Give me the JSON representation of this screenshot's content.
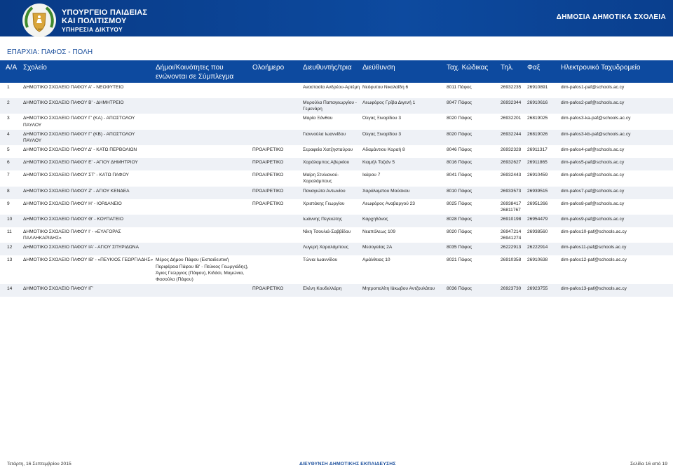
{
  "header": {
    "ministry_line1": "ΥΠΟΥΡΓΕΙΟ ΠΑΙΔΕΙΑΣ",
    "ministry_line2": "ΚΑΙ ΠΟΛΙΤΙΣΜΟΥ",
    "ministry_line3": "ΥΠΗΡΕΣΙΑ ΔΙΚΤΥΟΥ",
    "doc_title": "ΔΗΜΟΣΙΑ ΔΗΜΟΤΙΚΑ ΣΧΟΛΕΙΑ",
    "emblem_icon": "cyprus-emblem-icon"
  },
  "province_label": "ΕΠΑΡΧΙΑ:  ΠΑΦΟΣ - ΠΟΛΗ",
  "columns": {
    "aa": "Α/Α",
    "school": "Σχολείο",
    "communities": "Δήμοι/Κοινότητες που ενώνονται σε Σύμπλεγμα",
    "allday": "Ολοήμερο",
    "principal": "Διευθυντής/τρια",
    "address": "Διεύθυνση",
    "postcode": "Ταχ. Κώδικας",
    "phone": "Τηλ.",
    "fax": "Φαξ",
    "email": "Ηλεκτρονικό Ταχυδρομείο"
  },
  "rows": [
    {
      "aa": "1",
      "school": "ΔΗΜΟΤΙΚΟ ΣΧΟΛΕΙΟ ΠΑΦΟΥ Α' - ΝΕΟΦΥΤΕΙΟ",
      "communities": "",
      "allday": "",
      "principal": "Αναστασία Ανδρέου-Αρτέμη",
      "address": "Νεόφυτου Νικολαΐδη 6",
      "postcode": "8011 Πάφος",
      "phone": "26932235",
      "fax": "26910891",
      "email": "dim-pafos1-paf@schools.ac.cy"
    },
    {
      "aa": "2",
      "school": "ΔΗΜΟΤΙΚΟ ΣΧΟΛΕΙΟ ΠΑΦΟΥ Β' - ΔΗΜΗΤΡΕΙΟ",
      "communities": "",
      "allday": "",
      "principal": "Μυρούλα Παπαγεωργίου - Γεμενάρη",
      "address": "Λεωφόρος Γρίβα Διγενή 1",
      "postcode": "8047 Πάφος",
      "phone": "26932344",
      "fax": "26910616",
      "email": "dim-pafos2-paf@schools.ac.cy"
    },
    {
      "aa": "3",
      "school": "ΔΗΜΟΤΙΚΟ ΣΧΟΛΕΙΟ ΠΑΦΟΥ Γ' (ΚΑ) - ΑΠΟΣΤΟΛΟΥ ΠΑΥΛΟΥ",
      "communities": "",
      "allday": "",
      "principal": "Μαρία Ξάνθου",
      "address": "Όλγας Ξιναρίδου 3",
      "postcode": "8020 Πάφος",
      "phone": "26932201",
      "fax": "26819025",
      "email": "dim-pafos3-ka-paf@schools.ac.cy"
    },
    {
      "aa": "4",
      "school": "ΔΗΜΟΤΙΚΟ ΣΧΟΛΕΙΟ ΠΑΦΟΥ Γ' (ΚΒ) - ΑΠΟΣΤΟΛΟΥ ΠΑΥΛΟΥ",
      "communities": "",
      "allday": "",
      "principal": "Γιαννούλα Ιωαννίδου",
      "address": "Όλγας Ξιναρίδου 3",
      "postcode": "8020 Πάφος",
      "phone": "26932244",
      "fax": "26819026",
      "email": "dim-pafos3-kb-paf@schools.ac.cy"
    },
    {
      "aa": "5",
      "school": "ΔΗΜΟΤΙΚΟ ΣΧΟΛΕΙΟ ΠΑΦΟΥ Δ' - ΚΑΤΩ ΠΕΡΒΟΛΙΩΝ",
      "communities": "",
      "allday": "ΠΡΟΑΙΡΕΤΙΚΟ",
      "principal": "Σεραφεία Χατζησταύρου",
      "address": "Αδαμάντιου Κοραή 8",
      "postcode": "8046 Πάφος",
      "phone": "26932328",
      "fax": "26911317",
      "email": "dim-pafos4-paf@schools.ac.cy"
    },
    {
      "aa": "6",
      "school": "ΔΗΜΟΤΙΚΟ ΣΧΟΛΕΙΟ ΠΑΦΟΥ Ε' - ΑΓΙΟΥ ΔΗΜΗΤΡΙΟΥ",
      "communities": "",
      "allday": "ΠΡΟΑΙΡΕΤΙΚΟ",
      "principal": "Χαράλαμπος Αβερκίου",
      "address": "Κιαμήλ Τοζιάν 5",
      "postcode": "8016 Πάφος",
      "phone": "26932627",
      "fax": "26911865",
      "email": "dim-pafos5-paf@schools.ac.cy"
    },
    {
      "aa": "7",
      "school": "ΔΗΜΟΤΙΚΟ ΣΧΟΛΕΙΟ ΠΑΦΟΥ ΣΤ' - ΚΑΤΩ ΠΑΦΟΥ",
      "communities": "",
      "allday": "ΠΡΟΑΙΡΕΤΙΚΟ",
      "principal": "Μαίρη Στυλιανού-Χαραλάμπους",
      "address": "Ικάρου 7",
      "postcode": "8041 Πάφος",
      "phone": "26932443",
      "fax": "26910459",
      "email": "dim-pafos6-paf@schools.ac.cy"
    },
    {
      "aa": "8",
      "school": "ΔΗΜΟΤΙΚΟ ΣΧΟΛΕΙΟ ΠΑΦΟΥ Ζ' - ΑΓΙΟΥ ΚΕΝΔΕΑ",
      "communities": "",
      "allday": "ΠΡΟΑΙΡΕΤΙΚΟ",
      "principal": "Παναγιώτα Αντωνίου",
      "address": "Χαράλαμπου Μούσκου",
      "postcode": "8010 Πάφος",
      "phone": "26933573",
      "fax": "26939515",
      "email": "dim-pafos7-paf@schools.ac.cy"
    },
    {
      "aa": "9",
      "school": "ΔΗΜΟΤΙΚΟ ΣΧΟΛΕΙΟ ΠΑΦΟΥ Η' - ΙΟΡΔΑΝΕΙΟ",
      "communities": "",
      "allday": "ΠΡΟΑΙΡΕΤΙΚΟ",
      "principal": "Χριστάκης Γεωργίου",
      "address": "Λεωφόρος Αναβαργού 23",
      "postcode": "8025 Πάφος",
      "phone": "26938417\n26811767",
      "fax": "26951266",
      "email": "dim-pafos8-paf@schools.ac.cy"
    },
    {
      "aa": "10",
      "school": "ΔΗΜΟΤΙΚΟ ΣΧΟΛΕΙΟ ΠΑΦΟΥ Θ' - ΚΟΥΠΑΤΕΙΟ",
      "communities": "",
      "allday": "",
      "principal": "Ιωάννης Πεγειώτης",
      "address": "Καρχηδόνος",
      "postcode": "8028 Πάφος",
      "phone": "26910198",
      "fax": "26954479",
      "email": "dim-pafos9-paf@schools.ac.cy"
    },
    {
      "aa": "11",
      "school": "ΔΗΜΟΤΙΚΟ ΣΧΟΛΕΙΟ ΠΑΦΟΥ Ι' - «ΕΥΑΓΟΡΑΣ ΠΑΛΛΗΚΑΡΙΔΗΣ»",
      "communities": "",
      "allday": "",
      "principal": "Νίκη Τσουλιά-Σαββίδου",
      "address": "Νεαπόλεως 109",
      "postcode": "8020 Πάφος",
      "phone": "26947214\n26941274",
      "fax": "26938560",
      "email": "dim-pafos10-paf@schools.ac.cy"
    },
    {
      "aa": "12",
      "school": "ΔΗΜΟΤΙΚΟ ΣΧΟΛΕΙΟ ΠΑΦΟΥ ΙΑ' - ΑΓΙΟΥ ΣΠΥΡΙΔΩΝΑ",
      "communities": "",
      "allday": "",
      "principal": "Λυγερή Χαραλάμπους",
      "address": "Μεσογειίας 2Α",
      "postcode": "8035 Πάφος",
      "phone": "26222913",
      "fax": "26222914",
      "email": "dim-pafos11-paf@schools.ac.cy"
    },
    {
      "aa": "13",
      "school": "ΔΗΜΟΤΙΚΟ ΣΧΟΛΕΙΟ ΠΑΦΟΥ ΙΒ' - «ΠΕΥΚΙΟΣ ΓΕΩΡΓΙΑΔΗΣ»",
      "communities": "Μέρος Δήμου Πάφου (Εκπαιδευτική Περιφέρεια Πάφου ΙΒ' - Πεύκιος Γεωργιάδης), Άγιος Γεώργιος (Πάφου), Κιδάσι, Μαμώνια, Φασούλα (Πάφου)",
      "allday": "",
      "principal": "Τώνια Ιωαννίδου",
      "address": "Αμάλθειας 10",
      "postcode": "8021 Πάφος",
      "phone": "26910358",
      "fax": "26910638",
      "email": "dim-pafos12-paf@schools.ac.cy"
    },
    {
      "aa": "14",
      "school": "ΔΗΜΟΤΙΚΟ ΣΧΟΛΕΙΟ ΠΑΦΟΥ ΙΓ'",
      "communities": "",
      "allday": "ΠΡΟΑΙΡΕΤΙΚΟ",
      "principal": "Ελένη Κουδελλάρη",
      "address": "Μητροπολίτη Ιάκωβου Αντζουλάτου",
      "postcode": "8036 Πάφος",
      "phone": "26923730",
      "fax": "26923755",
      "email": "dim-pafos13-paf@schools.ac.cy"
    }
  ],
  "footer": {
    "date": "Τετάρτη, 16 Σεπτεμβρίου 2015",
    "directorate": "ΔΙΕΥΘΥΝΣΗ ΔΗΜΟΤΙΚΗΣ ΕΚΠΑΙΔΕΥΣΗΣ",
    "page": "Σελίδα 16 από 19"
  }
}
